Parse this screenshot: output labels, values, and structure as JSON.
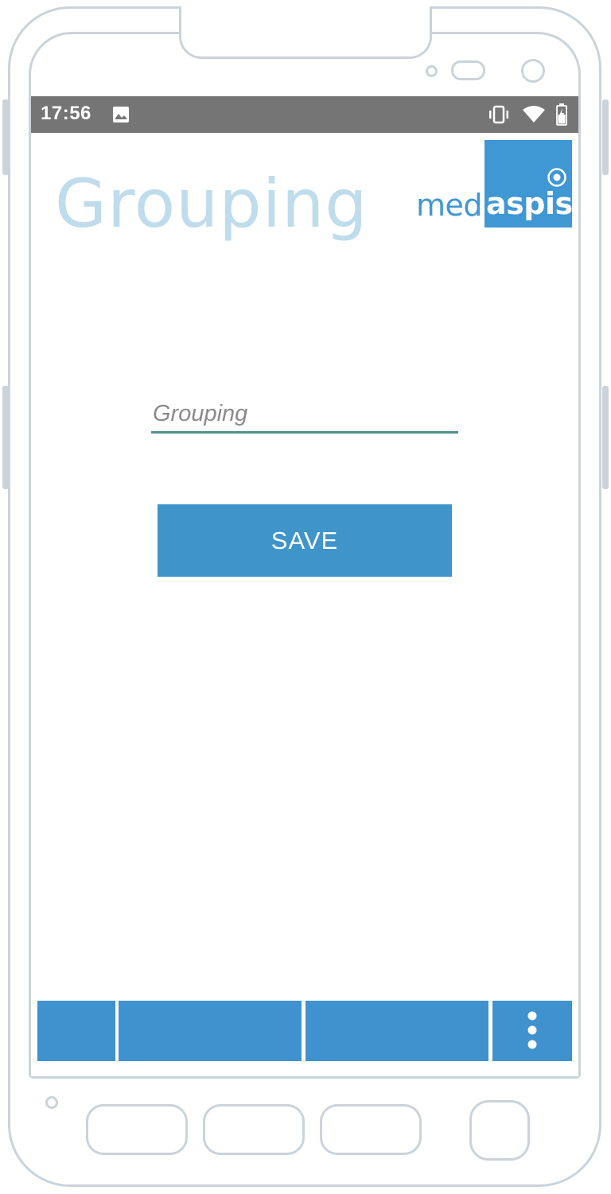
{
  "statusbar": {
    "time": "17:56",
    "icons": [
      "image-icon",
      "vibrate-icon",
      "wifi-icon",
      "battery-charging-icon"
    ]
  },
  "header": {
    "title": "Grouping",
    "logo": {
      "left_text": "med",
      "right_text": "aspis"
    }
  },
  "form": {
    "grouping_placeholder": "Grouping",
    "grouping_value": "",
    "save_label": "SAVE"
  },
  "bottom_bar": {
    "buttons": [
      "",
      "",
      "",
      "more-vertical-icon"
    ]
  },
  "colors": {
    "accent": "#3f94ca",
    "title": "#bfdcec",
    "underline": "#4f928a",
    "statusbar": "#757575",
    "frame": "#cbd3da"
  }
}
